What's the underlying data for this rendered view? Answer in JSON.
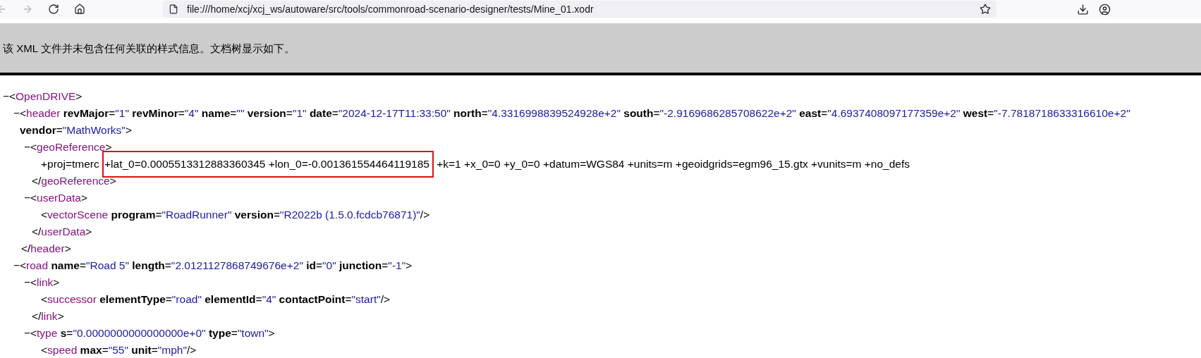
{
  "browser": {
    "nav_buttons": [
      {
        "kind": "back",
        "disabled": true
      },
      {
        "kind": "forward",
        "disabled": true
      },
      {
        "kind": "reload",
        "disabled": false
      },
      {
        "kind": "home",
        "disabled": false
      }
    ],
    "url": "file:///home/xcj/xcj_ws/autoware/src/tools/commonroad-scenario-designer/tests/Mine_01.xodr",
    "toolbar_icons": [
      {
        "kind": "download"
      },
      {
        "kind": "account"
      }
    ]
  },
  "notice": "该 XML 文件并未包含任何关联的样式信息。文档树显示如下。",
  "syntax": {
    "open": "<",
    "close": ">",
    "end_open": "</",
    "self_close": "/>",
    "eq": "=",
    "quote": "\""
  },
  "tree": {
    "kind": "element",
    "toggle": "−",
    "name": "OpenDRIVE",
    "children": [
      {
        "kind": "element",
        "toggle": "−",
        "name": "header",
        "closing_name": "header",
        "attributes": [
          {
            "name": "revMajor",
            "value": "1"
          },
          {
            "name": "revMinor",
            "value": "4"
          },
          {
            "name": "name"
          },
          {
            "name": "version",
            "value": "1"
          },
          {
            "name": "date",
            "value": "2024-12-17T11:33:50"
          },
          {
            "name": "north",
            "value": "4.3316998839524928e+2"
          },
          {
            "name": "south",
            "value": "-2.9169686285708622e+2"
          },
          {
            "name": "east",
            "value": "4.6937408097177359e+2"
          },
          {
            "name": "west",
            "value": "-7.7818718633316610e+2"
          },
          {
            "name": "vendor",
            "value": "MathWorks"
          }
        ],
        "children": [
          {
            "kind": "element",
            "toggle": "−",
            "name": "geoReference",
            "closing_name": "geoReference",
            "children": [
              {
                "kind": "text",
                "segments": [
                  {
                    "text": "+proj=tmerc ",
                    "highlighted": false
                  },
                  {
                    "text": "+lat_0=0.0005513312883360345 +lon_0=-0.001361554464119185",
                    "highlighted": true
                  },
                  {
                    "text": " +k=1 +x_0=0 +y_0=0 +datum=WGS84 +units=m +geoidgrids=egm96_15.gtx +vunits=m +no_defs",
                    "highlighted": false
                  }
                ]
              }
            ]
          },
          {
            "kind": "element",
            "toggle": "−",
            "name": "userData",
            "closing_name": "userData",
            "children": [
              {
                "kind": "element",
                "name": "vectorScene",
                "attributes": [
                  {
                    "name": "program",
                    "value": "RoadRunner"
                  },
                  {
                    "name": "version",
                    "value": "R2022b (1.5.0.fcdcb76871)"
                  }
                ]
              }
            ]
          }
        ]
      },
      {
        "kind": "element",
        "toggle": "−",
        "name": "road",
        "attributes": [
          {
            "name": "name",
            "value": "Road 5"
          },
          {
            "name": "length",
            "value": "2.0121127868749676e+2"
          },
          {
            "name": "id",
            "value": "0"
          },
          {
            "name": "junction",
            "value": "-1"
          }
        ],
        "children": [
          {
            "kind": "element",
            "toggle": "−",
            "name": "link",
            "closing_name": "link",
            "children": [
              {
                "kind": "element",
                "name": "successor",
                "attributes": [
                  {
                    "name": "elementType",
                    "value": "road"
                  },
                  {
                    "name": "elementId",
                    "value": "4"
                  },
                  {
                    "name": "contactPoint",
                    "value": "start"
                  }
                ]
              }
            ]
          },
          {
            "kind": "element",
            "toggle": "−",
            "name": "type",
            "attributes": [
              {
                "name": "s",
                "value": "0.0000000000000000e+0"
              },
              {
                "name": "type",
                "value": "town"
              }
            ],
            "children": [
              {
                "kind": "element",
                "name": "speed",
                "attributes": [
                  {
                    "name": "max",
                    "value": "55"
                  },
                  {
                    "name": "unit",
                    "value": "mph"
                  }
                ]
              }
            ]
          }
        ]
      }
    ]
  }
}
